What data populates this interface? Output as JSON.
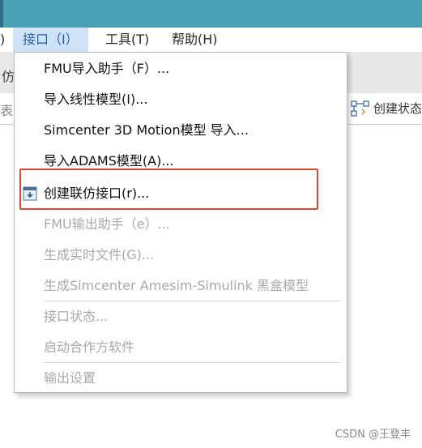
{
  "menubar": {
    "left_fragment": ")",
    "items": [
      {
        "label": "接口（I）",
        "active": true
      },
      {
        "label": "工具(T)",
        "active": false
      },
      {
        "label": "帮助(H)",
        "active": false
      }
    ]
  },
  "ribbon": {
    "left_fragment": "仿",
    "row2_fragment": "表",
    "create_state_label": "创建状态"
  },
  "dropdown": {
    "items": [
      {
        "label": "FMU导入助手（F）...",
        "enabled": true
      },
      {
        "label": "导入线性模型(I)...",
        "enabled": true
      },
      {
        "label": "Simcenter 3D Motion模型 导入...",
        "enabled": true
      },
      {
        "label": "导入ADAMS模型(A)...",
        "enabled": true
      },
      {
        "label": "创建联仿接口(r)...",
        "enabled": true,
        "icon": "cosim-interface-icon"
      },
      {
        "label": "FMU输出助手（e）...",
        "enabled": false
      },
      {
        "label": "生成实时文件(G)...",
        "enabled": false
      },
      {
        "label": "生成Simcenter Amesim-Simulink 黑盒模型",
        "enabled": false
      },
      {
        "label": "接口状态...",
        "enabled": false
      },
      {
        "label": "启动合作方软件",
        "enabled": false
      },
      {
        "label": "输出设置",
        "enabled": false
      }
    ]
  },
  "watermark": "CSDN @王登丰",
  "colors": {
    "title_strip": "#4aa0b3",
    "active_menu_bg": "#cfe3f6",
    "highlight_border": "#e24533",
    "disabled_text": "#a9a9a9"
  }
}
